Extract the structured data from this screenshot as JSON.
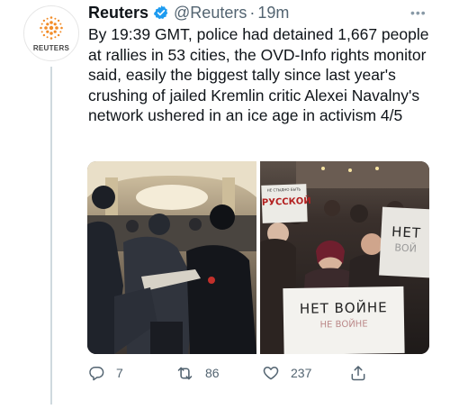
{
  "account": {
    "name": "Reuters",
    "handle": "@Reuters",
    "separator": "·",
    "time": "19m",
    "avatar_logo_text": "REUTERS"
  },
  "tweet": {
    "text": "By 19:39 GMT, police had detained 1,667 people at rallies in 53 cities, the OVD-Info rights monitor said, easily the biggest tally since last year's crushing of jailed Kremlin critic Alexei Navalny's network ushered in an ice age in activism 4/5"
  },
  "media": {
    "images": [
      {
        "icon": "photo-police-detaining-protester"
      },
      {
        "icon": "photo-protesters-with-signs"
      }
    ],
    "signs": {
      "top_small": "НЕ СТЫДНО БЫТЬ",
      "top_big": "РУССКОЙ",
      "right_big": "НЕТ",
      "right_small": "ВОЙ",
      "bottom_big": "НЕТ ВОЙНЕ",
      "bottom_small": "НЕ ВОЙНЕ"
    }
  },
  "actions": {
    "reply_count": "7",
    "retweet_count": "86",
    "like_count": "237"
  },
  "colors": {
    "verified": "#1d9bf0",
    "secondary_text": "#536471",
    "reuters_orange": "#f28c28"
  }
}
